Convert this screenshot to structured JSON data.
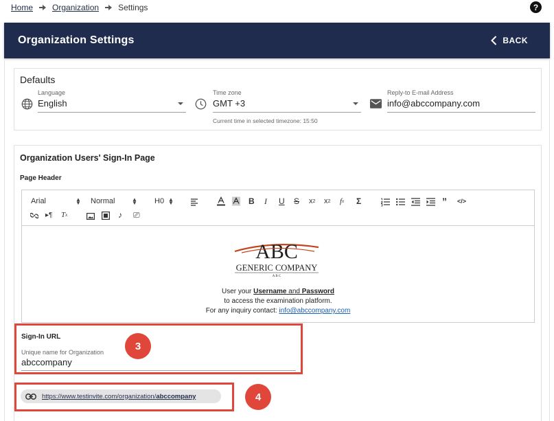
{
  "breadcrumb": {
    "home": "Home",
    "organization": "Organization",
    "current": "Settings"
  },
  "header": {
    "title": "Organization Settings",
    "back_label": "BACK"
  },
  "defaults": {
    "title": "Defaults",
    "language": {
      "label": "Language",
      "value": "English",
      "icon": "globe-icon"
    },
    "timezone": {
      "label": "Time zone",
      "value": "GMT +3",
      "hint": "Current time in selected timezone: 15:50",
      "icon": "clock-icon"
    },
    "reply_email": {
      "label": "Reply-to E-mail Address",
      "value": "info@abccompany.com",
      "icon": "mail-icon"
    }
  },
  "signin": {
    "title": "Organization Users' Sign-In Page",
    "page_header_label": "Page Header",
    "toolbar": {
      "font": "Arial",
      "size": "Normal",
      "heading": "H0"
    },
    "editor": {
      "logo_letters": "ABC",
      "logo_name": "GENERIC COMPANY",
      "logo_sub": "A B C",
      "line1_prefix": "User your ",
      "line1_username": "Username",
      "line1_and": " and ",
      "line1_password": "Password",
      "line2": "to access the examination platform.",
      "line3_prefix": "For any inquiry contact: ",
      "line3_email": "info@abccompany.com"
    },
    "url": {
      "title": "Sign-In URL",
      "field_label": "Unique name for Organization",
      "field_value": "abccompany",
      "badge": "3"
    },
    "link": {
      "prefix": "https://www.testinvite.com/organization/",
      "slug": "abccompany",
      "badge": "4"
    }
  },
  "colors": {
    "header_bg": "#1f2c4d",
    "highlight": "#e0463a",
    "link": "#1a5fb4"
  }
}
